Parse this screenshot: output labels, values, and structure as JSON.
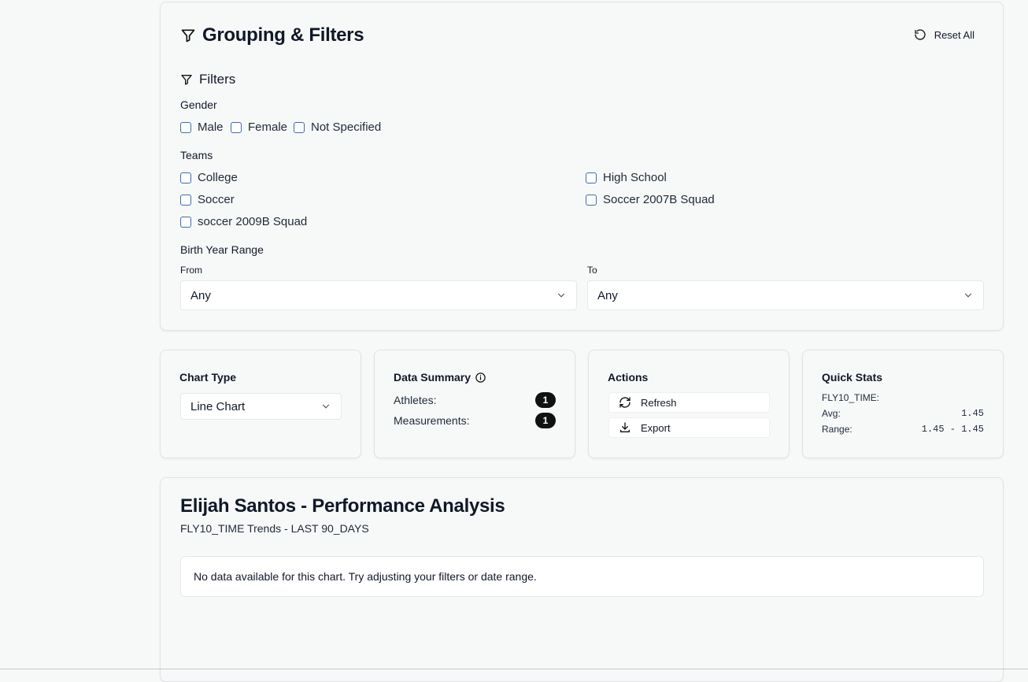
{
  "filters": {
    "title": "Grouping & Filters",
    "reset_label": "Reset All",
    "subtitle": "Filters",
    "gender": {
      "label": "Gender",
      "options": [
        "Male",
        "Female",
        "Not Specified"
      ]
    },
    "teams": {
      "label": "Teams",
      "options": [
        "College",
        "High School",
        "Soccer",
        "Soccer 2007B Squad",
        "soccer 2009B Squad"
      ]
    },
    "birth_year": {
      "label": "Birth Year Range",
      "from_label": "From",
      "from_value": "Any",
      "to_label": "To",
      "to_value": "Any"
    }
  },
  "chart_type": {
    "title": "Chart Type",
    "value": "Line Chart"
  },
  "data_summary": {
    "title": "Data Summary",
    "athletes_label": "Athletes:",
    "athletes_count": "1",
    "measurements_label": "Measurements:",
    "measurements_count": "1"
  },
  "actions": {
    "title": "Actions",
    "refresh_label": "Refresh",
    "export_label": "Export"
  },
  "quick_stats": {
    "title": "Quick Stats",
    "metric": "FLY10_TIME:",
    "avg_label": "Avg:",
    "avg_value": "1.45",
    "range_label": "Range:",
    "range_value": "1.45 - 1.45"
  },
  "analysis": {
    "title": "Elijah Santos - Performance Analysis",
    "subtitle": "FLY10_TIME Trends - LAST 90_DAYS",
    "empty_message": "No data available for this chart. Try adjusting your filters or date range."
  }
}
